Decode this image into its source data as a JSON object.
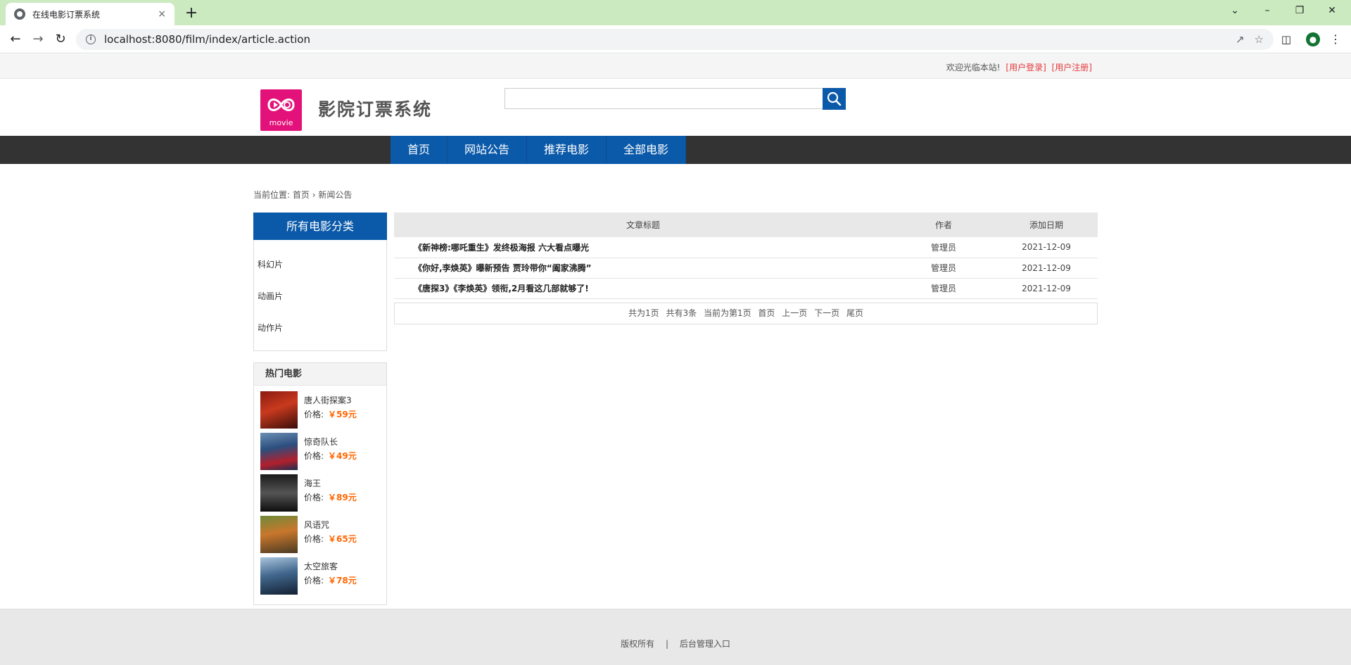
{
  "browser": {
    "tab_title": "在线电影订票系统",
    "tab_close": "×",
    "new_tab": "+",
    "url": "localhost:8080/film/index/article.action"
  },
  "topbar": {
    "welcome": "欢迎光临本站!",
    "login": "[用户登录]",
    "register": "[用户注册]"
  },
  "header": {
    "logo_text": "movie",
    "site_title": "影院订票系统",
    "search_placeholder": ""
  },
  "nav": {
    "items": [
      {
        "label": "首页"
      },
      {
        "label": "网站公告"
      },
      {
        "label": "推荐电影"
      },
      {
        "label": "全部电影"
      }
    ]
  },
  "breadcrumb": {
    "prefix": "当前位置:",
    "home": "首页",
    "sep": "›",
    "current": "新闻公告"
  },
  "sidebar": {
    "categories_title": "所有电影分类",
    "categories": [
      {
        "label": "科幻片"
      },
      {
        "label": "动画片"
      },
      {
        "label": "动作片"
      }
    ],
    "hot_title": "热门电影",
    "hot_movies": [
      {
        "name": "唐人街探案3",
        "price_label": "价格:",
        "price": "￥59元"
      },
      {
        "name": "惊奇队长",
        "price_label": "价格:",
        "price": "￥49元"
      },
      {
        "name": "海王",
        "price_label": "价格:",
        "price": "￥89元"
      },
      {
        "name": "风语咒",
        "price_label": "价格:",
        "price": "￥65元"
      },
      {
        "name": "太空旅客",
        "price_label": "价格:",
        "price": "￥78元"
      }
    ]
  },
  "articles": {
    "headers": {
      "title": "文章标题",
      "author": "作者",
      "date": "添加日期"
    },
    "rows": [
      {
        "title": "《新神榜:哪吒重生》发终极海报 六大看点曝光",
        "author": "管理员",
        "date": "2021-12-09"
      },
      {
        "title": "《你好,李焕英》曝新预告 贾玲带你“阖家沸腾”",
        "author": "管理员",
        "date": "2021-12-09"
      },
      {
        "title": "《唐探3》《李焕英》领衔,2月看这几部就够了!",
        "author": "管理员",
        "date": "2021-12-09"
      }
    ]
  },
  "pagination": {
    "total_pages": "共为1页",
    "total_items": "共有3条",
    "current": "当前为第1页",
    "first": "首页",
    "prev": "上一页",
    "next": "下一页",
    "last": "尾页"
  },
  "footer": {
    "copyright": "版权所有",
    "separator": "|",
    "admin_link": "后台管理入口"
  },
  "colors": {
    "brand_blue": "#0b5aa9",
    "nav_dark": "#333333",
    "logo_pink": "#e3127b",
    "price_orange": "#ff6600",
    "link_red": "#e4393c"
  }
}
